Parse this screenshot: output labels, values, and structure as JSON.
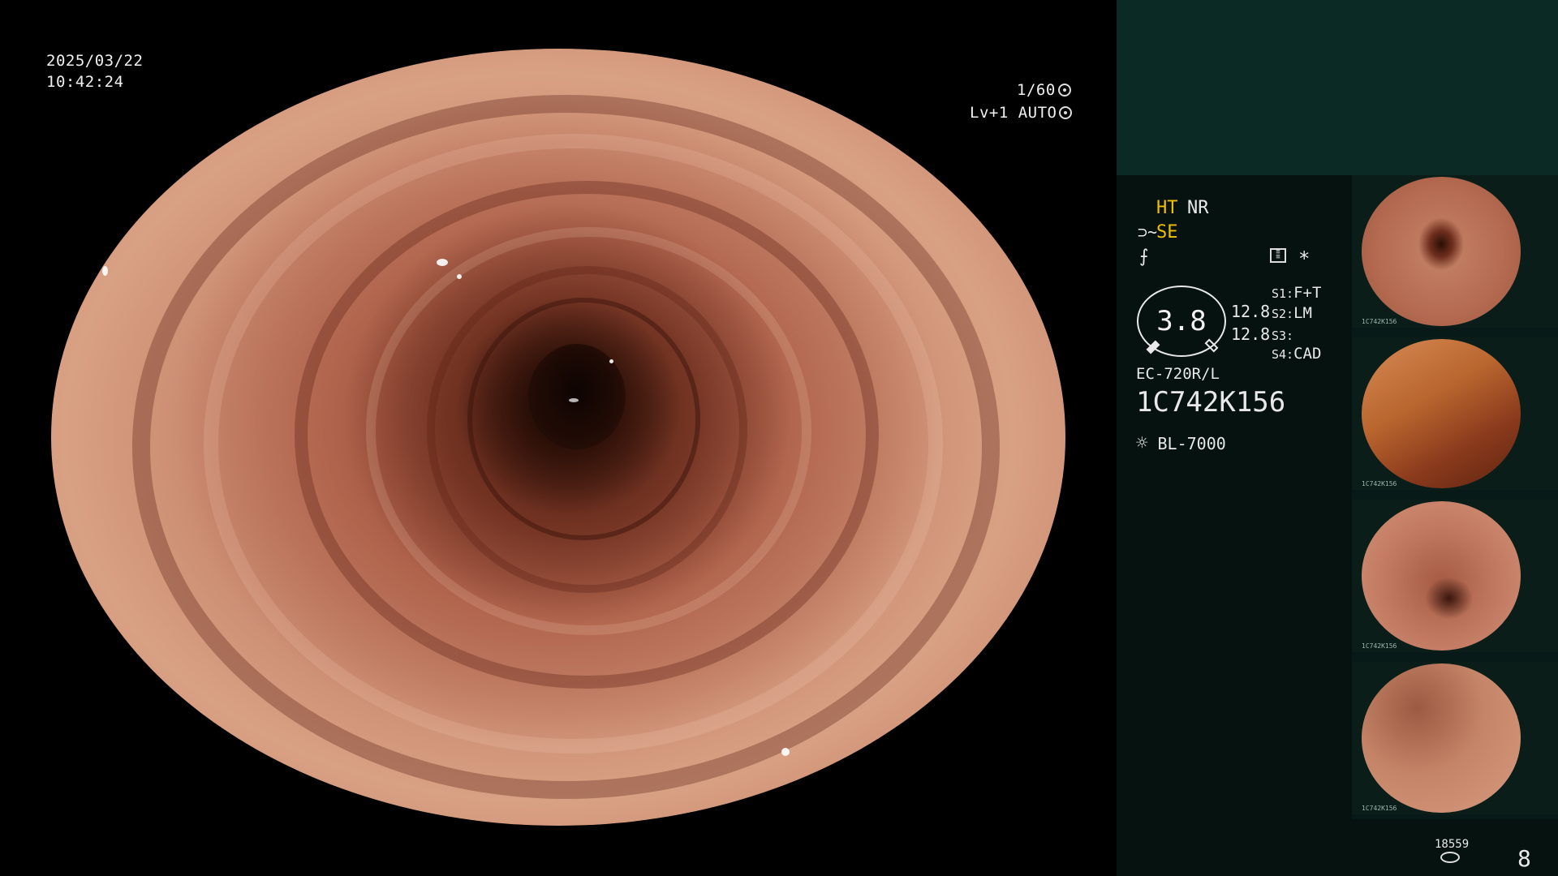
{
  "main_overlay": {
    "date": "2025/03/22",
    "time": "10:42:24",
    "shutter": "1/60",
    "level": "Lv+1",
    "mode": "AUTO"
  },
  "info_panel": {
    "ht_label": "HT",
    "nr_label": "NR",
    "se_label": "SE",
    "asterisk": "*",
    "gauge_value": "3.8",
    "value_upper": "12.8",
    "value_lower": "12.8",
    "switches": [
      {
        "key": "S1:",
        "value": "F+T"
      },
      {
        "key": "S2:",
        "value": "LM"
      },
      {
        "key": "S3:",
        "value": ""
      },
      {
        "key": "S4:",
        "value": "CAD"
      }
    ],
    "scope_model": "EC-720R/L",
    "scope_serial": "1C742K156",
    "light_source": "BL-7000"
  },
  "thumbnails": [
    {
      "caption_top": "1C742K156"
    },
    {
      "caption_top": "1C742K156"
    },
    {
      "caption_top": "1C742K156"
    },
    {
      "caption_top": "1C742K156"
    }
  ],
  "footer": {
    "image_count": "18559",
    "page_number": "8"
  },
  "colors": {
    "accent_yellow": "#f0c000",
    "panel_dark": "#061210",
    "panel_teal": "#0b2a26"
  }
}
